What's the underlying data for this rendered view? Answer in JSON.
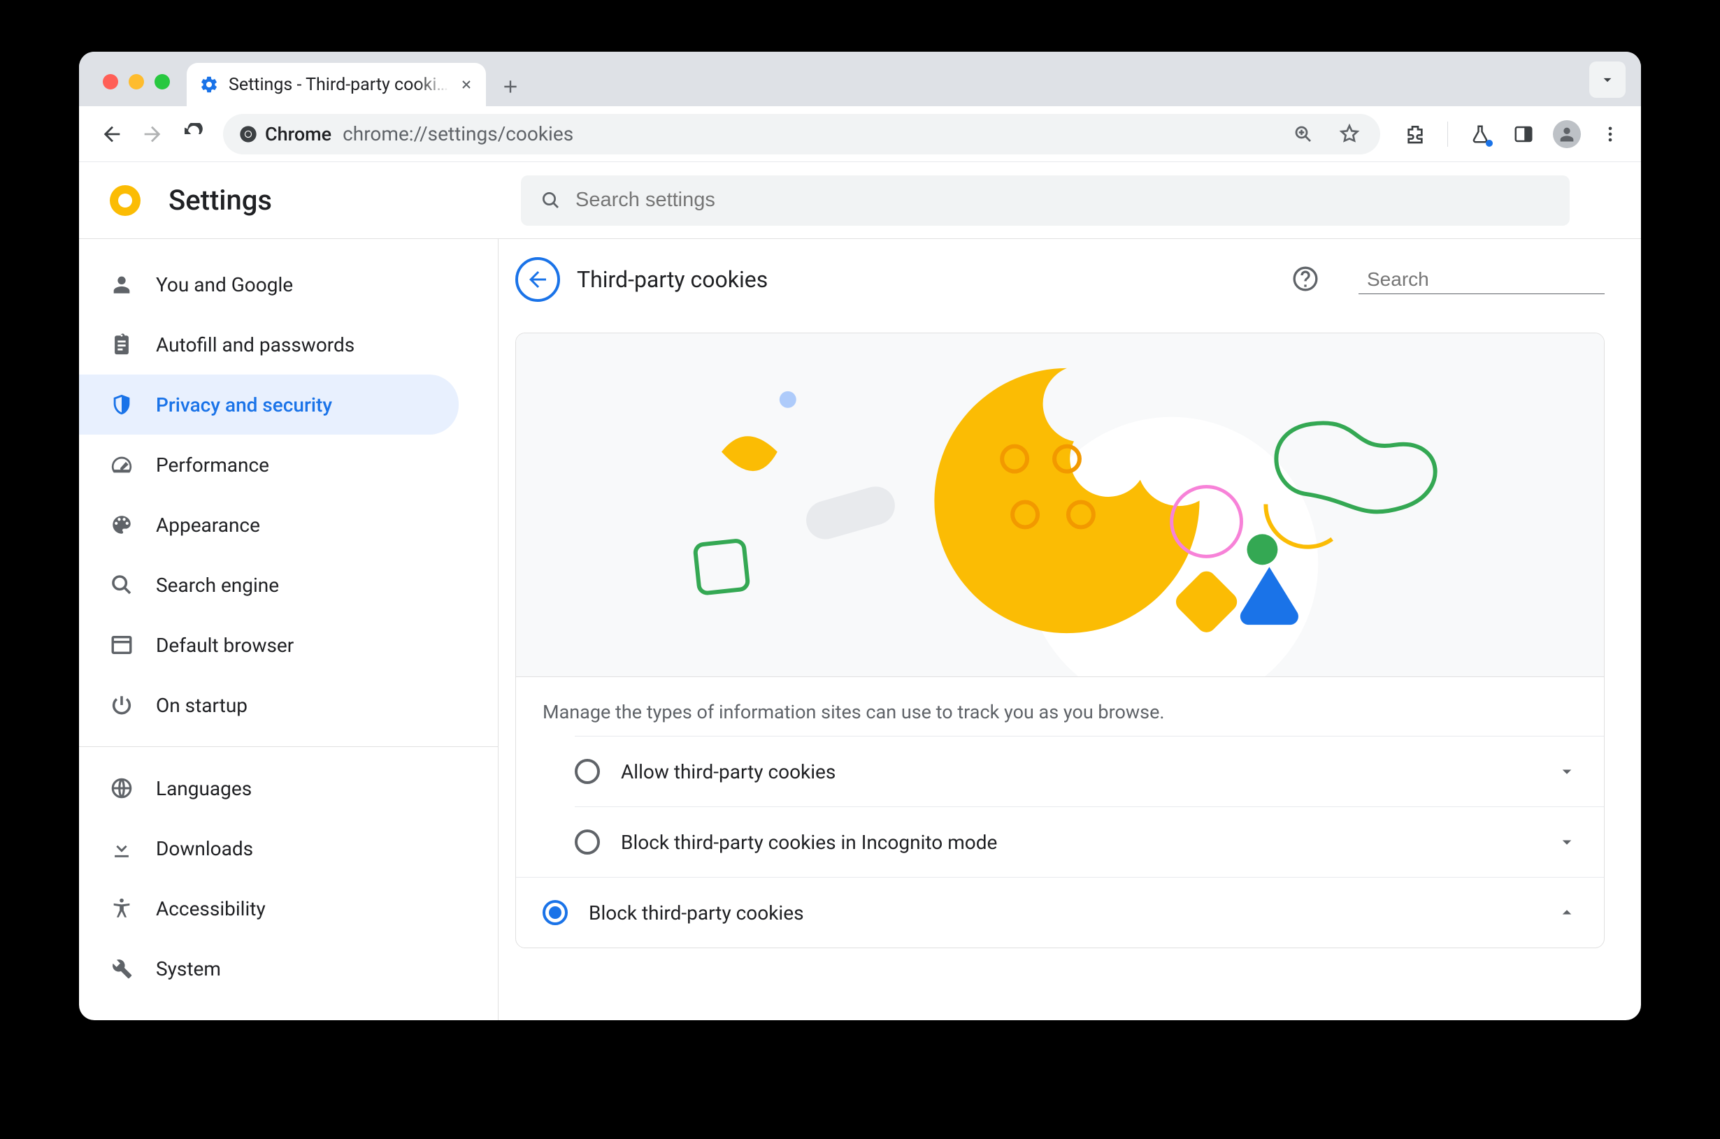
{
  "browser_tab": {
    "title": "Settings - Third-party cookies"
  },
  "address_bar": {
    "scheme_label": "Chrome",
    "url": "chrome://settings/cookies"
  },
  "app": {
    "title": "Settings"
  },
  "search_settings": {
    "placeholder": "Search settings"
  },
  "sidebar": {
    "items": [
      {
        "label": "You and Google"
      },
      {
        "label": "Autofill and passwords"
      },
      {
        "label": "Privacy and security"
      },
      {
        "label": "Performance"
      },
      {
        "label": "Appearance"
      },
      {
        "label": "Search engine"
      },
      {
        "label": "Default browser"
      },
      {
        "label": "On startup"
      }
    ],
    "items2": [
      {
        "label": "Languages"
      },
      {
        "label": "Downloads"
      },
      {
        "label": "Accessibility"
      },
      {
        "label": "System"
      }
    ]
  },
  "page": {
    "title": "Third-party cookies",
    "search_placeholder": "Search",
    "description": "Manage the types of information sites can use to track you as you browse.",
    "options": [
      {
        "label": "Allow third-party cookies",
        "selected": false,
        "expanded": false
      },
      {
        "label": "Block third-party cookies in Incognito mode",
        "selected": false,
        "expanded": false
      },
      {
        "label": "Block third-party cookies",
        "selected": true,
        "expanded": true
      }
    ]
  }
}
